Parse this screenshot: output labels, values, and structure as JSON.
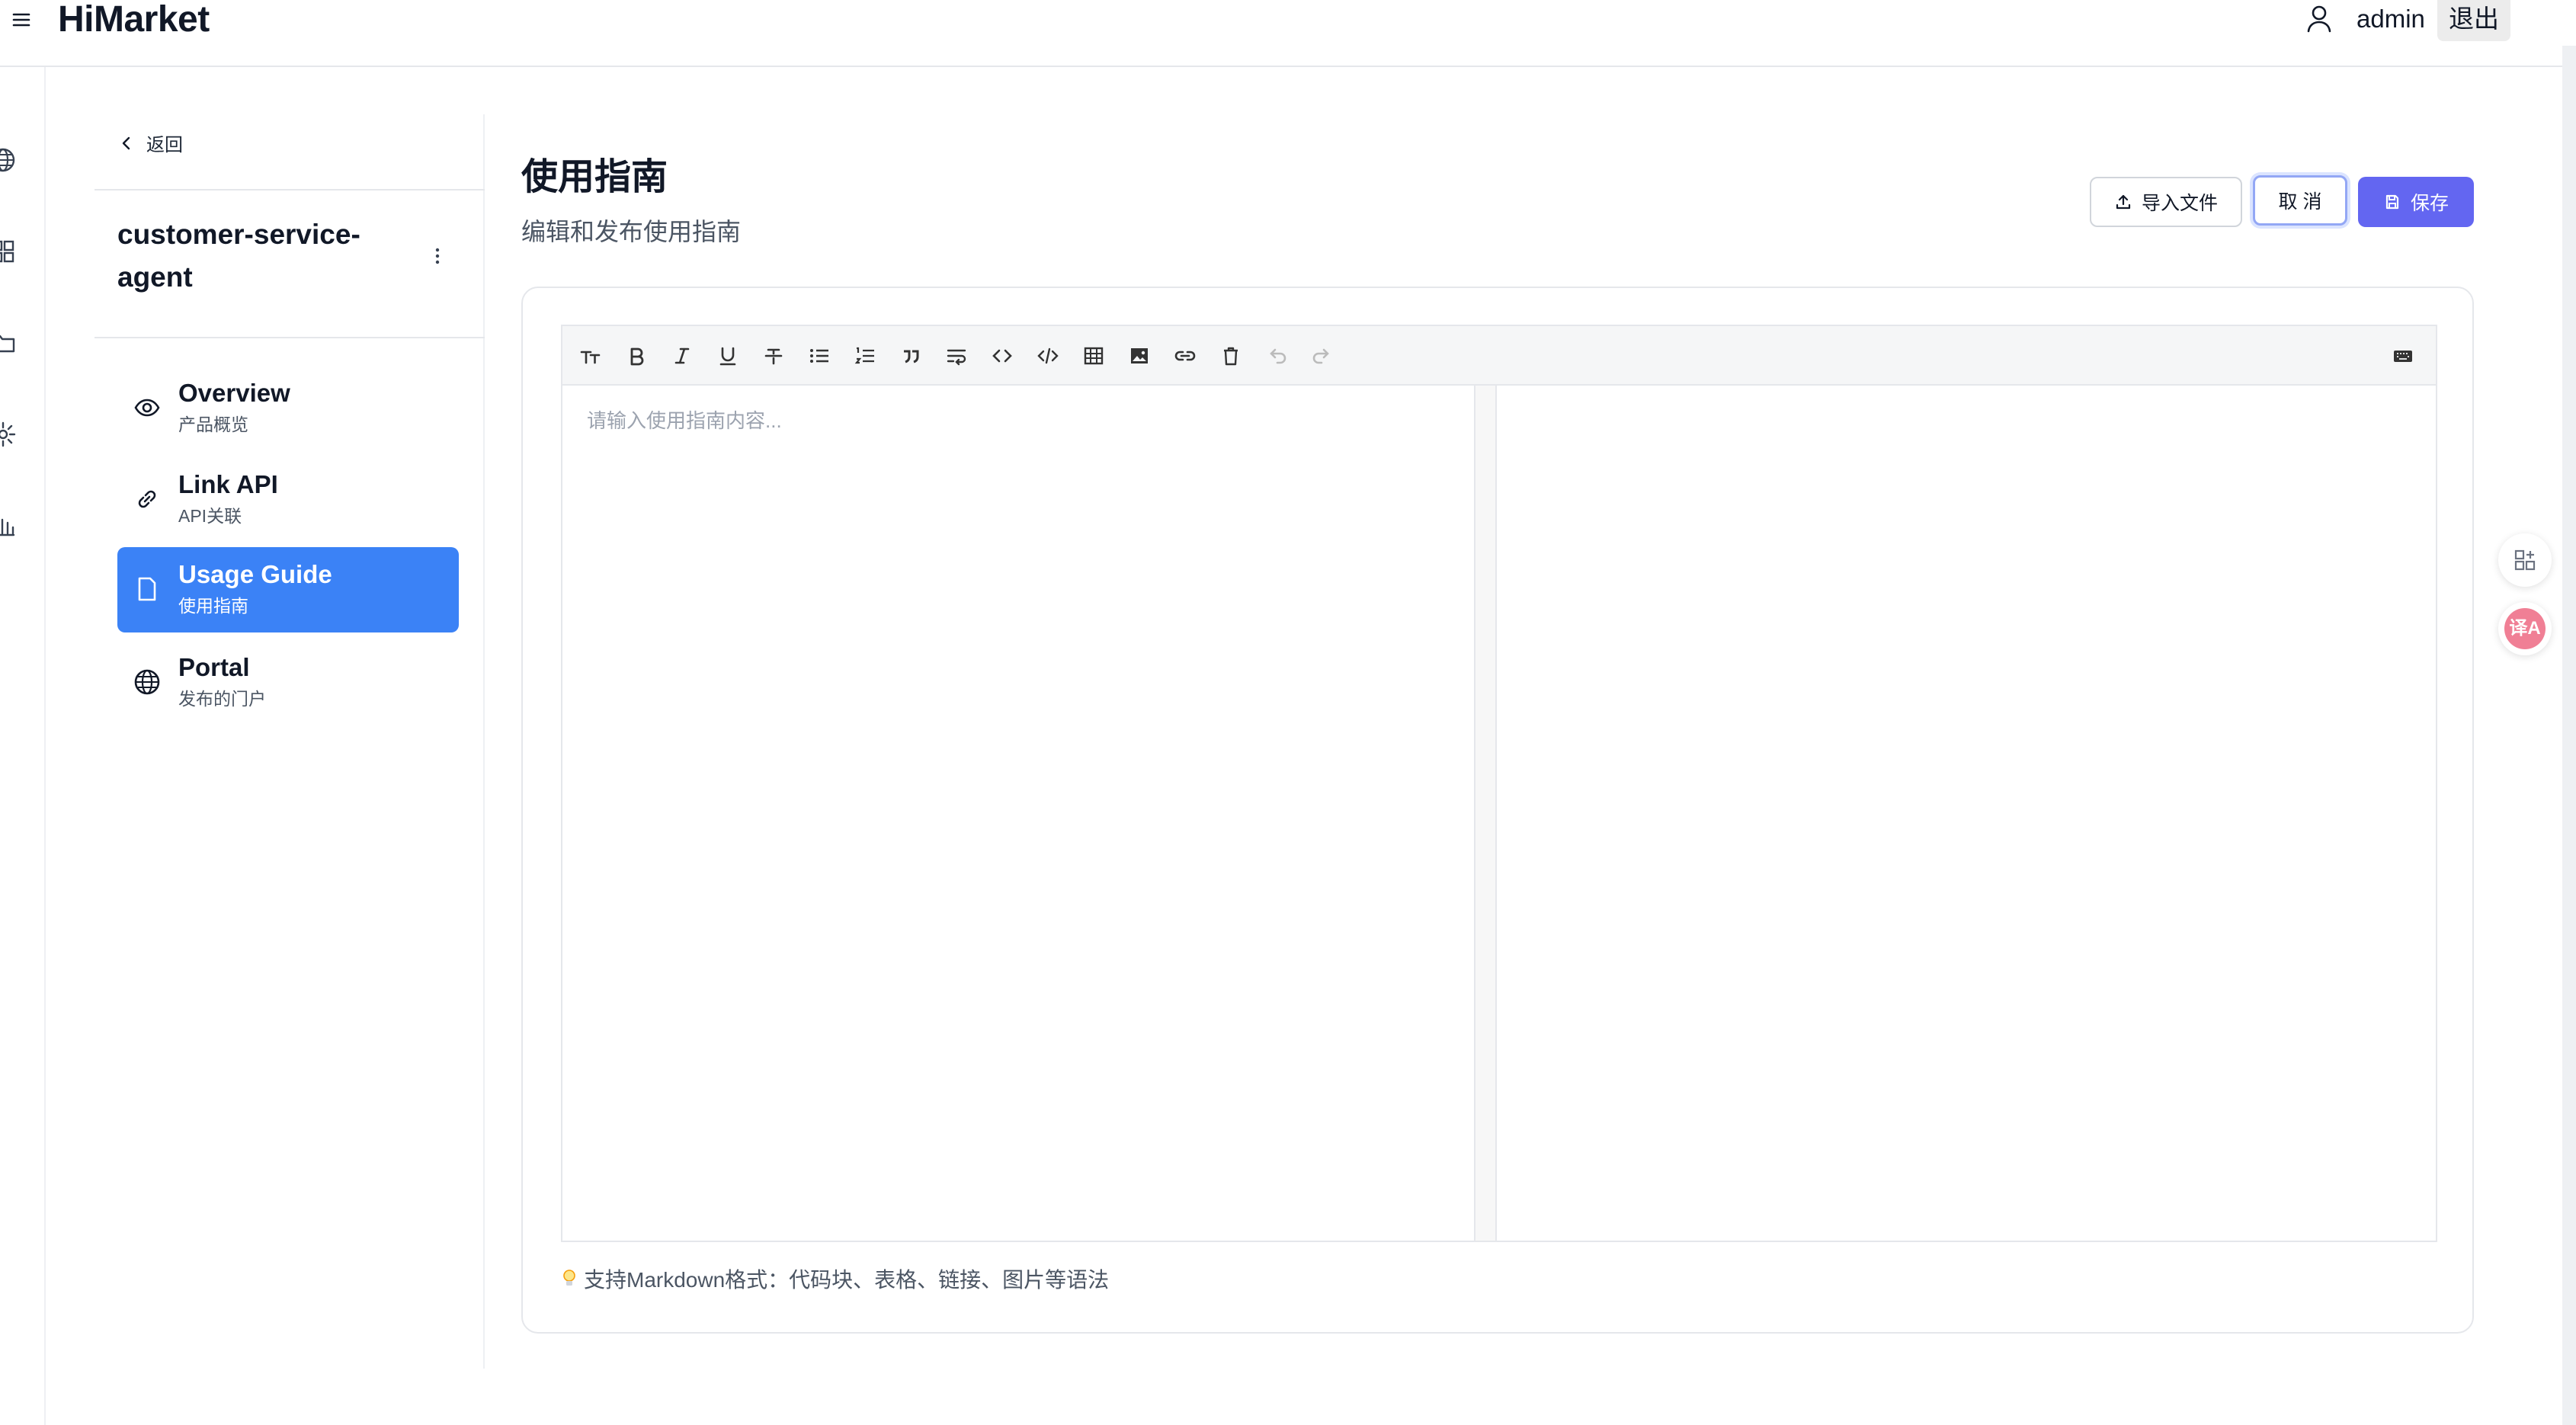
{
  "header": {
    "logo": "HiMarket",
    "username": "admin",
    "logout_label": "退出"
  },
  "rail": {
    "icons": [
      "globe-icon",
      "grid-icon",
      "folder-icon",
      "settings-icon",
      "bar-chart-icon"
    ]
  },
  "sidebar": {
    "back_label": "返回",
    "product_name": "customer-service-agent",
    "items": [
      {
        "title": "Overview",
        "subtitle": "产品概览",
        "icon": "eye-icon",
        "active": false
      },
      {
        "title": "Link API",
        "subtitle": "API关联",
        "icon": "link-icon",
        "active": false
      },
      {
        "title": "Usage Guide",
        "subtitle": "使用指南",
        "icon": "document-icon",
        "active": true
      },
      {
        "title": "Portal",
        "subtitle": "发布的门户",
        "icon": "globe-icon",
        "active": false
      }
    ]
  },
  "main": {
    "title": "使用指南",
    "subtitle": "编辑和发布使用指南",
    "buttons": {
      "import": "导入文件",
      "cancel": "取 消",
      "save": "保存"
    },
    "editor": {
      "placeholder": "请输入使用指南内容...",
      "toolbar": [
        "heading-icon",
        "bold-icon",
        "italic-icon",
        "underline-icon",
        "strikethrough-icon",
        "bullet-list-icon",
        "ordered-list-icon",
        "quote-icon",
        "wrap-icon",
        "inline-code-icon",
        "code-block-icon",
        "table-icon",
        "image-icon",
        "link-icon",
        "delete-icon",
        "undo-icon",
        "redo-icon",
        "keyboard-icon"
      ]
    },
    "hint": "支持Markdown格式：代码块、表格、链接、图片等语法"
  },
  "floating": {
    "translate_label": "译A"
  },
  "colors": {
    "accent_blue": "#3b82f6",
    "save_button": "#6366f1",
    "cancel_focus": "#93a7f5",
    "translate_badge": "#f07f95"
  }
}
